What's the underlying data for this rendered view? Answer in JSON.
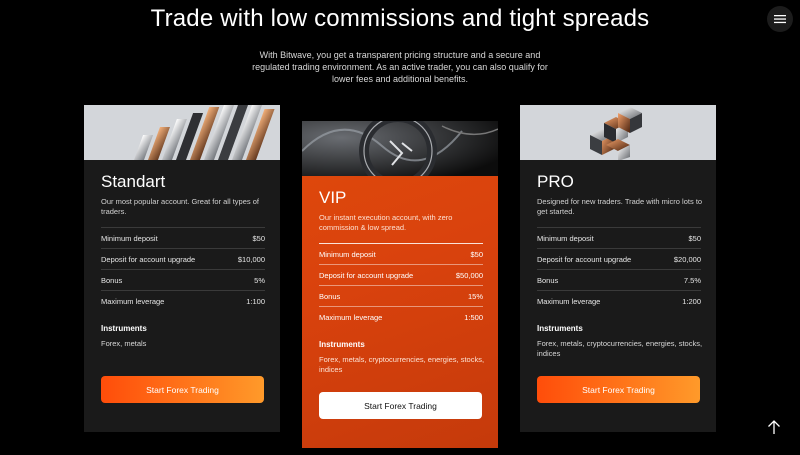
{
  "header": {
    "title": "Trade with low commissions and tight spreads",
    "subtitle": "With Bitwave, you get a transparent pricing structure and a secure and regulated trading environment. As an active trader, you can also qualify for lower fees and additional benefits."
  },
  "icons": {
    "menu": "hamburger-menu-icon",
    "scroll_top": "arrow-up-icon"
  },
  "colors": {
    "accent_gradient_start": "#ff4d0a",
    "accent_gradient_end": "#ff9a2a",
    "vip_card": "#d9420d",
    "card_bg": "#1a1a1a",
    "page_bg": "#000000"
  },
  "cards": [
    {
      "name": "Standart",
      "description": "Our most popular account. Great for all types of traders.",
      "rows": [
        {
          "label": "Minimum deposit",
          "value": "$50"
        },
        {
          "label": "Deposit for account upgrade",
          "value": "$10,000"
        },
        {
          "label": "Bonus",
          "value": "5%"
        },
        {
          "label": "Maximum leverage",
          "value": "1:100"
        }
      ],
      "instruments_title": "Instruments",
      "instruments": "Forex, metals",
      "cta": "Start Forex Trading"
    },
    {
      "name": "VIP",
      "description": "Our instant execution account, with zero commission & low spread.",
      "rows": [
        {
          "label": "Minimum deposit",
          "value": "$50"
        },
        {
          "label": "Deposit for account upgrade",
          "value": "$50,000"
        },
        {
          "label": "Bonus",
          "value": "15%"
        },
        {
          "label": "Maximum leverage",
          "value": "1:500"
        }
      ],
      "instruments_title": "Instruments",
      "instruments": "Forex, metals, cryptocurrencies, energies, stocks, indices",
      "cta": "Start Forex Trading"
    },
    {
      "name": "PRO",
      "description": "Designed for new traders. Trade with micro lots to get started.",
      "rows": [
        {
          "label": "Minimum deposit",
          "value": "$50"
        },
        {
          "label": "Deposit for account upgrade",
          "value": "$20,000"
        },
        {
          "label": "Bonus",
          "value": "7.5%"
        },
        {
          "label": "Maximum leverage",
          "value": "1:200"
        }
      ],
      "instruments_title": "Instruments",
      "instruments": "Forex, metals, cryptocurrencies, energies, stocks, indices",
      "cta": "Start Forex Trading"
    }
  ]
}
